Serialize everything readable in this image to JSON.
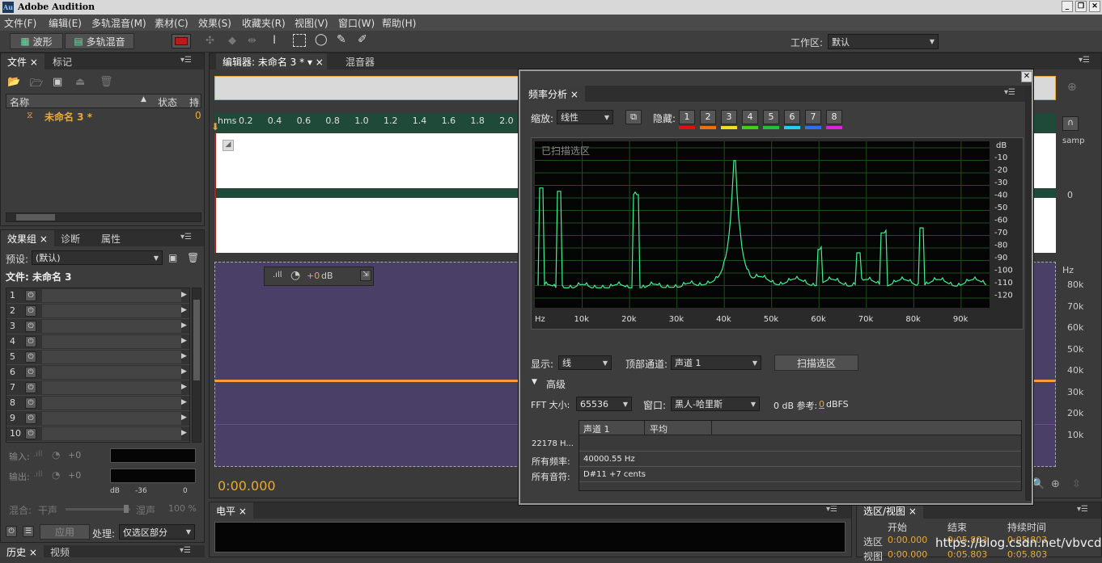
{
  "app": {
    "icon_text": "Au",
    "title": "Adobe Audition"
  },
  "window_controls": {
    "minimize": "_",
    "restore": "❐",
    "close": "✕"
  },
  "menu": [
    "文件(F)",
    "编辑(E)",
    "多轨混音(M)",
    "素材(C)",
    "效果(S)",
    "收藏夹(R)",
    "视图(V)",
    "窗口(W)",
    "帮助(H)"
  ],
  "toolbar": {
    "waveform": "波形",
    "multitrack": "多轨混音",
    "workspace_label": "工作区:",
    "workspace_value": "默认"
  },
  "files_panel": {
    "tabs": [
      "文件",
      "标记"
    ],
    "col_name": "名称",
    "col_status": "状态",
    "col_extra": "持",
    "file_name": "未命名 3 *",
    "file_value": "0"
  },
  "effects_panel": {
    "tabs": [
      "效果组",
      "诊断",
      "属性"
    ],
    "preset_label": "预设:",
    "preset_value": "(默认)",
    "file_label": "文件: 未命名 3",
    "slots": [
      "1",
      "2",
      "3",
      "4",
      "5",
      "6",
      "7",
      "8",
      "9",
      "10"
    ],
    "input_label": "输入:",
    "input_value": "+0",
    "output_label": "输出:",
    "output_value": "+0",
    "meter_db": "dB",
    "meter_mid": "-36",
    "meter_zero": "0",
    "mix_label": "混合:",
    "mix_dry": "干声",
    "mix_wet": "湿声",
    "mix_pct": "100 %",
    "apply": "应用",
    "process_label": "处理:",
    "process_value": "仅选区部分"
  },
  "bottom_left_tabs": [
    "历史",
    "视频"
  ],
  "editor": {
    "tabs": [
      "编辑器: 未命名 3 *",
      "混音器"
    ],
    "ruler": [
      "hms",
      "0.2",
      "0.4",
      "0.6",
      "0.8",
      "1.0",
      "1.2",
      "1.4",
      "1.6",
      "1.8",
      "2.0"
    ],
    "hud_gain": "+0",
    "hud_db": "dB",
    "time": "0:00.000",
    "right_unit": "samp",
    "right_zero": "0",
    "hz_label": "Hz",
    "hz_ticks": [
      "80k",
      "70k",
      "60k",
      "50k",
      "40k",
      "30k",
      "20k",
      "10k"
    ]
  },
  "level_panel": {
    "tab": "电平"
  },
  "selection_panel": {
    "tab": "选区/视图",
    "col_start": "开始",
    "col_end": "结束",
    "col_duration": "持续时间",
    "row1_label": "选区",
    "row1_start": "0:00.000",
    "row1_end": "0:05.803",
    "row1_dur": "0:05.803",
    "row2_label": "视图",
    "row2_start": "0:00.000",
    "row2_end": "0:05.803",
    "row2_dur": "0:05.803"
  },
  "watermark": "https://blog.csdn.net/vbvcde",
  "freq": {
    "tab": "频率分析",
    "zoom_label": "缩放:",
    "zoom_value": "线性",
    "hide_label": "隐藏:",
    "hide_buttons": [
      "1",
      "2",
      "3",
      "4",
      "5",
      "6",
      "7",
      "8"
    ],
    "hide_colors": [
      "#e01010",
      "#f07010",
      "#f0e020",
      "#40d020",
      "#20c040",
      "#20d0f0",
      "#3070f0",
      "#e020e0"
    ],
    "plot_title": "已扫描选区",
    "db_unit": "dB",
    "db_ticks": [
      "-10",
      "-20",
      "-30",
      "-40",
      "-50",
      "-60",
      "-70",
      "-80",
      "-90",
      "-100",
      "-110",
      "-120"
    ],
    "hz_ticks": [
      "Hz",
      "10k",
      "20k",
      "30k",
      "40k",
      "50k",
      "60k",
      "70k",
      "80k",
      "90k"
    ],
    "display_label": "显示:",
    "display_value": "线",
    "channel_label": "顶部通道:",
    "channel_value": "声道 1",
    "scan_button": "扫描选区",
    "advanced": "高级",
    "fft_label": "FFT 大小:",
    "fft_value": "65536",
    "window_label": "窗口:",
    "window_value": "黑人-哈里斯",
    "ref_label": "0 dB 参考:",
    "ref_value": "0",
    "ref_unit": "dBFS",
    "table_col1": "声道 1",
    "table_col2": "平均",
    "row1_label": "22178 H...",
    "row2_label": "所有频率:",
    "row2_value": "40000.55 Hz",
    "row3_label": "所有音符:",
    "row3_value": "D#11 +7 cents"
  }
}
